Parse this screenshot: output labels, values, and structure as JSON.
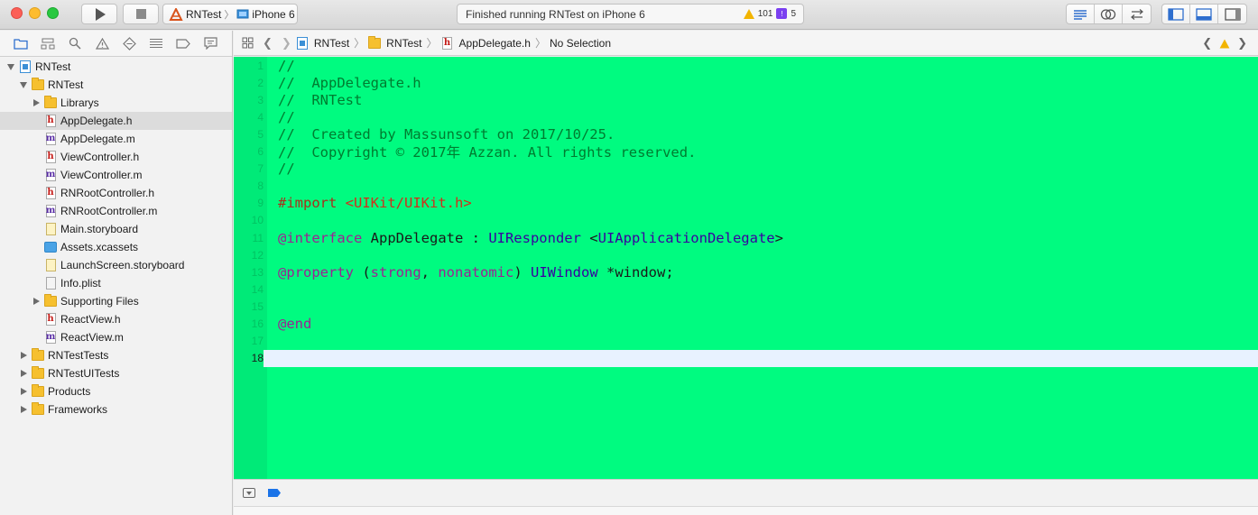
{
  "toolbar": {
    "scheme_project": "RNTest",
    "scheme_device": "iPhone 6",
    "status_text": "Finished running RNTest on iPhone 6",
    "warning_count": "101",
    "issue_count": "5"
  },
  "jumpbar": {
    "crumbs": [
      "RNTest",
      "RNTest",
      "AppDelegate.h",
      "No Selection"
    ]
  },
  "navigator": {
    "items": [
      {
        "label": "RNTest",
        "indent": 0,
        "disclosure": "open",
        "icon": "project"
      },
      {
        "label": "RNTest",
        "indent": 1,
        "disclosure": "open",
        "icon": "folder"
      },
      {
        "label": "Librarys",
        "indent": 2,
        "disclosure": "closed",
        "icon": "folder"
      },
      {
        "label": "AppDelegate.h",
        "indent": 2,
        "disclosure": "none",
        "icon": "h",
        "selected": true
      },
      {
        "label": "AppDelegate.m",
        "indent": 2,
        "disclosure": "none",
        "icon": "m"
      },
      {
        "label": "ViewController.h",
        "indent": 2,
        "disclosure": "none",
        "icon": "h"
      },
      {
        "label": "ViewController.m",
        "indent": 2,
        "disclosure": "none",
        "icon": "m"
      },
      {
        "label": "RNRootController.h",
        "indent": 2,
        "disclosure": "none",
        "icon": "h"
      },
      {
        "label": "RNRootController.m",
        "indent": 2,
        "disclosure": "none",
        "icon": "m"
      },
      {
        "label": "Main.storyboard",
        "indent": 2,
        "disclosure": "none",
        "icon": "storyboard"
      },
      {
        "label": "Assets.xcassets",
        "indent": 2,
        "disclosure": "none",
        "icon": "assets"
      },
      {
        "label": "LaunchScreen.storyboard",
        "indent": 2,
        "disclosure": "none",
        "icon": "storyboard"
      },
      {
        "label": "Info.plist",
        "indent": 2,
        "disclosure": "none",
        "icon": "plist"
      },
      {
        "label": "Supporting Files",
        "indent": 2,
        "disclosure": "closed",
        "icon": "folder"
      },
      {
        "label": "ReactView.h",
        "indent": 2,
        "disclosure": "none",
        "icon": "h"
      },
      {
        "label": "ReactView.m",
        "indent": 2,
        "disclosure": "none",
        "icon": "m"
      },
      {
        "label": "RNTestTests",
        "indent": 1,
        "disclosure": "closed",
        "icon": "folder"
      },
      {
        "label": "RNTestUITests",
        "indent": 1,
        "disclosure": "closed",
        "icon": "folder"
      },
      {
        "label": "Products",
        "indent": 1,
        "disclosure": "closed",
        "icon": "folder"
      },
      {
        "label": "Frameworks",
        "indent": 1,
        "disclosure": "closed",
        "icon": "folder"
      }
    ]
  },
  "editor": {
    "current_line": 18,
    "lines": [
      "//",
      "//  AppDelegate.h",
      "//  RNTest",
      "//",
      "//  Created by Massunsoft on 2017/10/25.",
      "//  Copyright © 2017年 Azzan. All rights reserved.",
      "//",
      "",
      "#import <UIKit/UIKit.h>",
      "",
      "@interface AppDelegate : UIResponder <UIApplicationDelegate>",
      "",
      "@property (strong, nonatomic) UIWindow *window;",
      "",
      "",
      "@end",
      "",
      ""
    ]
  },
  "colors": {
    "editor_background": "#00fb80",
    "comment": "#007c30",
    "keyword": "#9b2393",
    "string": "#d12f1b",
    "type": "#3900a0"
  }
}
